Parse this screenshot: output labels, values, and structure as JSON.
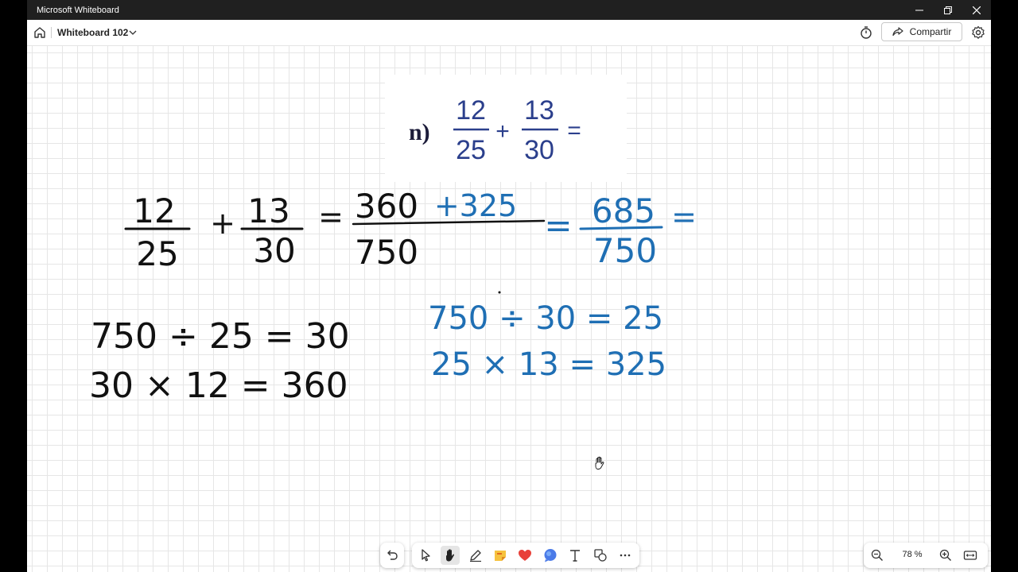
{
  "window": {
    "title": "Microsoft Whiteboard"
  },
  "header": {
    "board_name": "Whiteboard 102",
    "share_label": "Compartir"
  },
  "problem": {
    "label": "n)",
    "f1_num": "12",
    "f1_den": "25",
    "plus": "+",
    "f2_num": "13",
    "f2_den": "30",
    "equals": "="
  },
  "ink": {
    "line1_f1_num": "12",
    "line1_f1_den": "25",
    "line1_plus": "+",
    "line1_f2_num": "13",
    "line1_f2_den": "30",
    "line1_eq1": "=",
    "line1_num_black": "360",
    "line1_num_blue": "+325",
    "line1_den": "750",
    "line1_eq2": "=",
    "line1_result_num": "685",
    "line1_result_den": "750",
    "line1_eq3": "=",
    "black_row1": "750 ÷ 25 = 30",
    "black_row2": "30 × 12 = 360",
    "blue_row1": "750 ÷ 30 = 25",
    "blue_row2": "25 × 13 = 325"
  },
  "zoom": {
    "level": "78 %"
  },
  "colors": {
    "ink_black": "#111111",
    "ink_blue": "#1f6fb4",
    "problem_blue": "#2b3f8c"
  },
  "icons": [
    "home-icon",
    "chevron-down-icon",
    "timer-icon",
    "share-icon",
    "gear-icon",
    "undo-icon",
    "select-icon",
    "hand-icon",
    "pen-icon",
    "sticky-note-icon",
    "reaction-icon",
    "comment-icon",
    "text-icon",
    "shapes-icon",
    "more-icon",
    "zoom-out-icon",
    "zoom-in-icon",
    "fit-icon"
  ]
}
